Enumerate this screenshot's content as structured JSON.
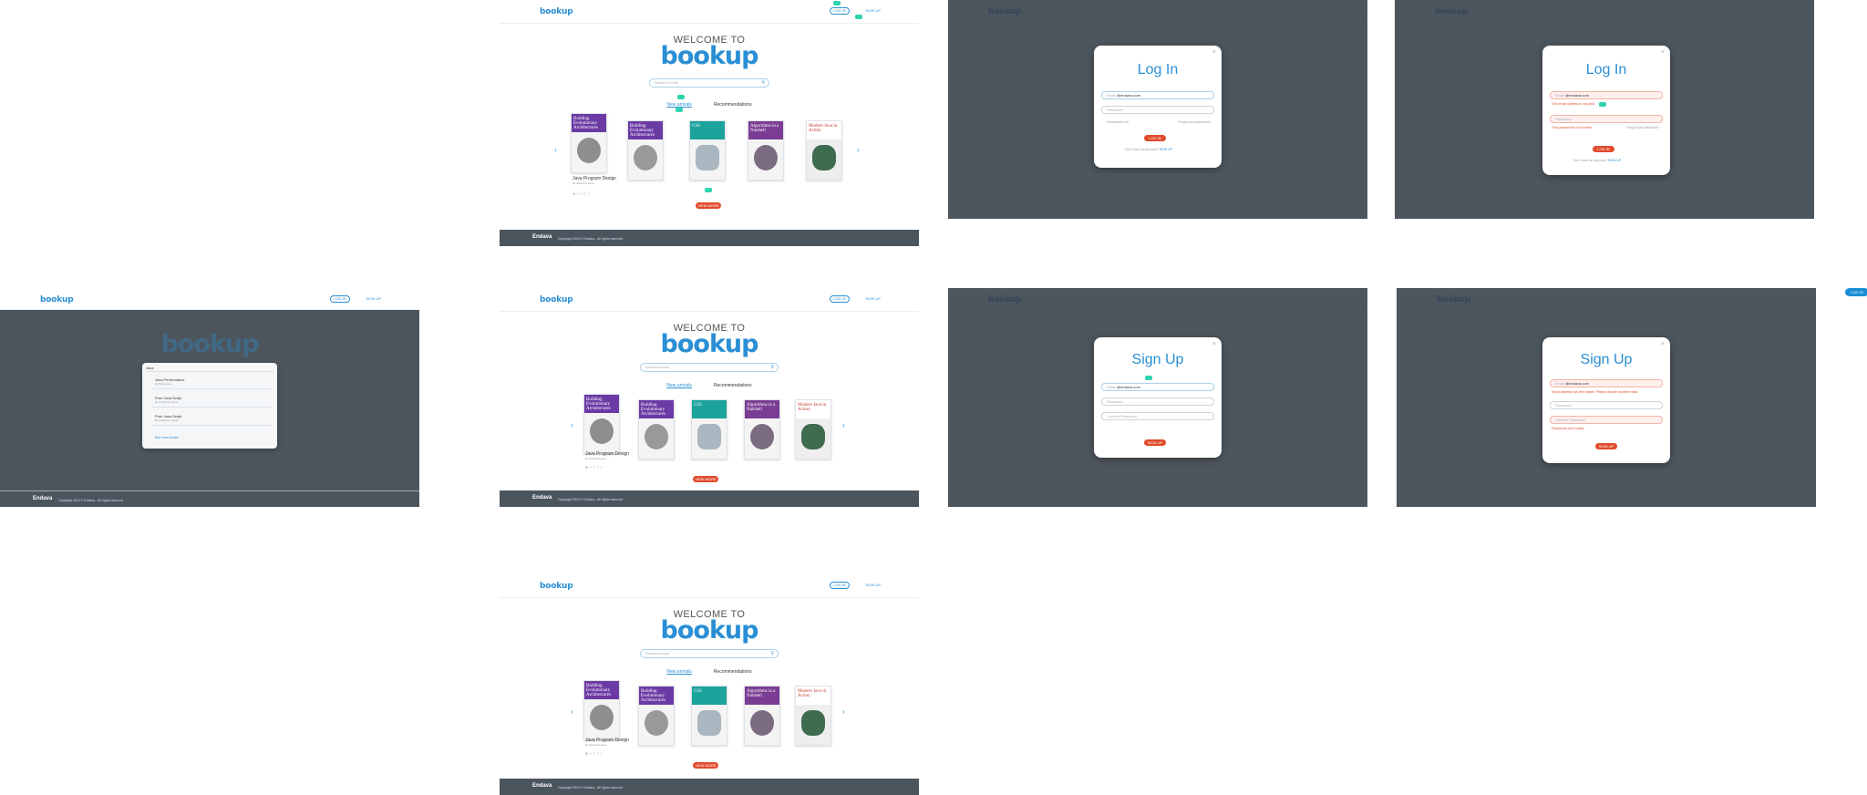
{
  "header": {
    "logo": "bookup",
    "login": "LOG IN",
    "signup": "SIGN UP"
  },
  "hero": {
    "welcome": "WELCOME TO",
    "brand": "bookup",
    "search_placeholder": "Search a book"
  },
  "tabs": {
    "new": "New arrivals",
    "rec": "Recommendations"
  },
  "books": [
    {
      "title": "Building Evolutionary Architectures"
    },
    {
      "title": "Building Evolutionary Architectures"
    },
    {
      "title": "CSS"
    },
    {
      "title": "Algorithms in a Nutshell"
    },
    {
      "title": "Modern Java in Action"
    }
  ],
  "first_book": {
    "name": "Java Program Design",
    "author": "By Edward Lance"
  },
  "view_more": "VIEW MORE",
  "footer": {
    "logo": "Endava",
    "copyright": "Copyright 2019 © Endava - All rights reserved"
  },
  "login_modal": {
    "title": "Log In",
    "email_label": "Email",
    "email_value": "@endava.com",
    "password_placeholder": "Password",
    "remember": "Remember me",
    "forgot": "Forgot your password?",
    "submit": "LOG IN",
    "no_account": "Don't have an account?",
    "signup_link": "SIGN UP",
    "email_error": "This email address is not valid",
    "password_error": "This password is not correct"
  },
  "signup_modal": {
    "title": "Sign Up",
    "email_label": "Email",
    "email_value": "@endava.com",
    "password_placeholder": "Password",
    "confirm_placeholder": "Confirm Password",
    "submit": "SIGN UP",
    "email_error": "Email address has been taken. Please choose another email.",
    "confirm_error": "Passwords don't match"
  },
  "search_results": {
    "query": "Java",
    "items": [
      {
        "name": "Java Performance",
        "author": "By Brian Cole"
      },
      {
        "name": "Pure Java Script",
        "author": "By Anderson Lausi"
      },
      {
        "name": "Pure Java Script",
        "author": "By Anderson Lausi"
      }
    ],
    "see_more": "See more books"
  },
  "floating_login": "LOG IN",
  "colors": {
    "accent": "#2a8fd4",
    "cta": "#e04b2c",
    "footer": "#4b555e",
    "overlay": "#343e47",
    "tag": "#2dd4ae"
  }
}
